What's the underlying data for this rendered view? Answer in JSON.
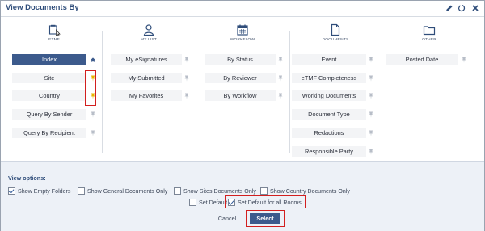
{
  "dialog": {
    "title": "View Documents By",
    "actions": [
      "edit-icon",
      "reset-icon",
      "close-icon"
    ]
  },
  "columns": [
    {
      "id": "etmf",
      "label": "ETMF",
      "icon": "etmf-binder-icon",
      "items": [
        {
          "label": "Index",
          "active": true,
          "pin": "home"
        },
        {
          "label": "Site",
          "pin": "yellow"
        },
        {
          "label": "Country",
          "pin": "yellow"
        },
        {
          "label": "Query By Sender",
          "pin": "gray"
        },
        {
          "label": "Query By Recipient",
          "pin": "gray"
        }
      ]
    },
    {
      "id": "mylist",
      "label": "MY LIST",
      "icon": "user-icon",
      "items": [
        {
          "label": "My eSignatures",
          "pin": "gray"
        },
        {
          "label": "My Submitted",
          "pin": "gray"
        },
        {
          "label": "My Favorites",
          "pin": "gray"
        }
      ]
    },
    {
      "id": "workflow",
      "label": "WORKFLOW",
      "icon": "calendar-icon",
      "items": [
        {
          "label": "By Status",
          "pin": "gray"
        },
        {
          "label": "By Reviewer",
          "pin": "gray"
        },
        {
          "label": "By Workflow",
          "pin": "gray"
        }
      ]
    },
    {
      "id": "documents",
      "label": "DOCUMENTS",
      "icon": "document-icon",
      "items": [
        {
          "label": "Event",
          "pin": "gray"
        },
        {
          "label": "eTMF Completeness",
          "pin": "gray"
        },
        {
          "label": "Working Documents",
          "pin": "gray"
        },
        {
          "label": "Document Type",
          "pin": "gray"
        },
        {
          "label": "Redactions",
          "pin": "gray"
        },
        {
          "label": "Responsible Party",
          "pin": "gray"
        }
      ]
    },
    {
      "id": "other",
      "label": "OTHER",
      "icon": "folder-icon",
      "items": [
        {
          "label": "Posted Date",
          "pin": "gray"
        }
      ]
    }
  ],
  "view_options": {
    "label": "View options:",
    "checkboxes": [
      {
        "label": "Show Empty Folders",
        "checked": true
      },
      {
        "label": "Show General Documents Only",
        "checked": false
      },
      {
        "label": "Show Sites Documents Only",
        "checked": false
      },
      {
        "label": "Show Country Documents Only",
        "checked": false
      }
    ],
    "set_default": {
      "label": "Set Default",
      "checked": false
    },
    "set_default_all": {
      "label": "Set Default for all Rooms",
      "checked": true
    }
  },
  "buttons": {
    "cancel": "Cancel",
    "select": "Select"
  },
  "colors": {
    "primary": "#3c5a8c",
    "highlight": "#d21f1f",
    "pin_yellow": "#e8b400",
    "panel": "#edf1f7"
  }
}
